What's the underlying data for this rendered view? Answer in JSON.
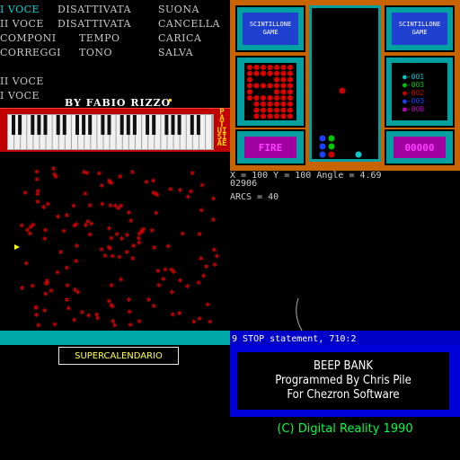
{
  "menu": {
    "rows": [
      [
        {
          "text": "I  VOCE",
          "highlight": true
        },
        {
          "text": "DISATTIVATA"
        },
        {
          "text": "SUONA"
        }
      ],
      [
        {
          "text": "II VOCE"
        },
        {
          "text": "DISATTIVATA"
        },
        {
          "text": "CANCELLA"
        }
      ],
      [
        {
          "text": "COMPONI"
        },
        {
          "text": "TEMPO"
        },
        {
          "text": "CARICA"
        }
      ],
      [
        {
          "text": "CORREGGI"
        },
        {
          "text": "TONO"
        },
        {
          "text": "SALVA"
        }
      ]
    ],
    "voice2": "II VOCE",
    "voice1": "I  VOCE",
    "byline": "BY FABIO RIZZO",
    "piano_logo": "P\nA\nT\nUI\nSI\nAE"
  },
  "tetris": {
    "badge": "SCINTILLONE GAME",
    "fire": "FIRE",
    "score": "00000",
    "stats": [
      {
        "value": "001",
        "color": "#00c8c8"
      },
      {
        "value": "003",
        "color": "#00c800"
      },
      {
        "value": "002",
        "color": "#c80000"
      },
      {
        "value": "003",
        "color": "#2040ff"
      },
      {
        "value": "000",
        "color": "#c000c0"
      }
    ]
  },
  "status": {
    "coords": "X = 100    Y = 100    Angle = 4.69",
    "score": "02906",
    "arcs": "ARCS = 40",
    "stop": "9 STOP statement, 710:2"
  },
  "supercalendario": "SUPERCALENDARIO",
  "beep": {
    "line1": "BEEP BANK",
    "line2": "Programmed By Chris Pile",
    "line3": "For Chezron Software"
  },
  "copyright": "(C) Digital Reality 1990",
  "colors": {
    "mine": "#c80000",
    "cyan": "#00a8a8",
    "blue": "#0000c8",
    "orange": "#c86400"
  }
}
